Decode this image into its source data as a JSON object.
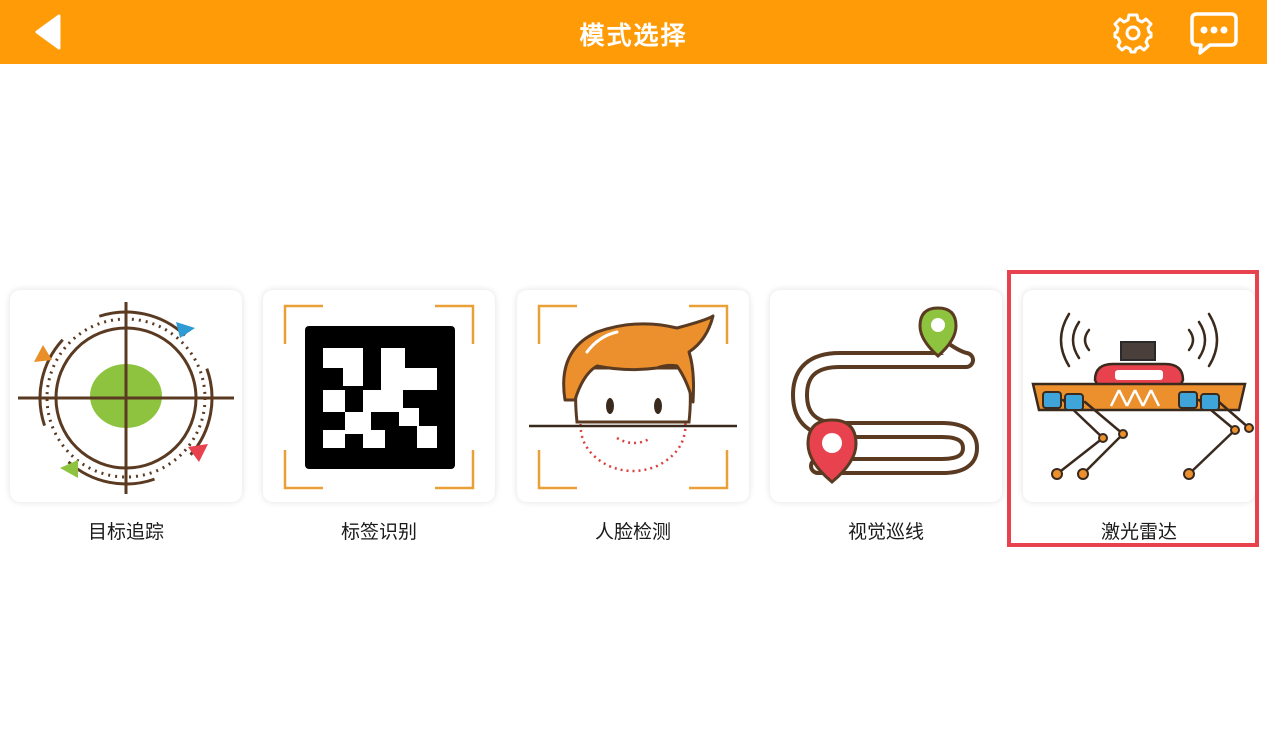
{
  "header": {
    "title": "模式选择",
    "background_color": "#FF9B06",
    "back_icon": "back-arrow-icon",
    "settings_icon": "gear-icon",
    "chat_icon": "chat-bubble-icon"
  },
  "modes": [
    {
      "label": "目标追踪",
      "icon": "target-tracking-icon"
    },
    {
      "label": "标签识别",
      "icon": "tag-recognition-icon"
    },
    {
      "label": "人脸检测",
      "icon": "face-detection-icon"
    },
    {
      "label": "视觉巡线",
      "icon": "line-following-icon"
    },
    {
      "label": "激光雷达",
      "icon": "lidar-robot-dog-icon",
      "selected": true
    }
  ],
  "selection_color": "#E8424F"
}
